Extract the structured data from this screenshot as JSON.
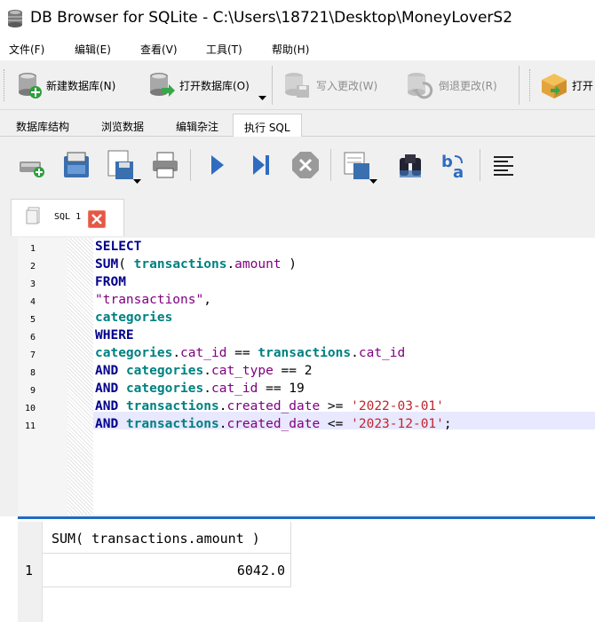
{
  "window": {
    "title": "DB Browser for SQLite - C:\\Users\\18721\\Desktop\\MoneyLoverS2"
  },
  "menu": [
    {
      "label": "文件(F)"
    },
    {
      "label": "编辑(E)"
    },
    {
      "label": "查看(V)"
    },
    {
      "label": "工具(T)"
    },
    {
      "label": "帮助(H)"
    }
  ],
  "toolbar": {
    "new_db": "新建数据库(N)",
    "open_db": "打开数据库(O)",
    "write_changes": "写入更改(W)",
    "revert_changes": "倒退更改(R)",
    "open_project": "打开"
  },
  "tabs": [
    {
      "label": "数据库结构"
    },
    {
      "label": "浏览数据"
    },
    {
      "label": "编辑杂注"
    },
    {
      "label": "执行 SQL"
    }
  ],
  "sql_tab": {
    "label": "SQL 1"
  },
  "editor": {
    "line_numbers": [
      "1",
      "2",
      "3",
      "4",
      "5",
      "6",
      "7",
      "8",
      "9",
      "10",
      "11"
    ],
    "tokens": {
      "select": "SELECT",
      "sum": "SUM",
      "paren_open": "( ",
      "transactions": "transactions",
      "dot": ".",
      "amount": "amount",
      "paren_close": " )",
      "from": "FROM",
      "q_transactions": "\"transactions\"",
      "comma": ",",
      "categories": "categories",
      "where": "WHERE",
      "cat_id": "cat_id",
      "eqeq": " == ",
      "and": "AND",
      "cat_type": "cat_type",
      "two": "2",
      "nineteen": "19",
      "created_date": "created_date",
      "gte": " >= ",
      "lte": " <= ",
      "date1": "'2022-03-01'",
      "date2": "'2023-12-01'",
      "semicolon": ";",
      "space": " "
    }
  },
  "results": {
    "columns": [
      "SUM( transactions.amount )"
    ],
    "rows": [
      {
        "rownum": "1",
        "values": [
          "6042.0"
        ]
      }
    ]
  }
}
